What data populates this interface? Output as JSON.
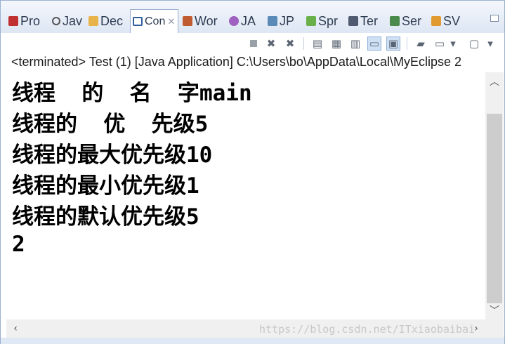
{
  "tabs": [
    {
      "label": "Pro",
      "icon": "problems-icon",
      "color": "#c03030"
    },
    {
      "label": "Jav",
      "icon": "javadoc-icon",
      "color": "#333333"
    },
    {
      "label": "Dec",
      "icon": "declaration-icon",
      "color": "#c88a20"
    },
    {
      "label": "Con",
      "icon": "console-icon",
      "color": "#3060a0",
      "active": true
    },
    {
      "label": "Wor",
      "icon": "workspace-icon",
      "color": "#b04020"
    },
    {
      "label": "JA",
      "icon": "jax-icon",
      "color": "#8040a0"
    },
    {
      "label": "JP",
      "icon": "jpa-icon",
      "color": "#2a6a9a"
    },
    {
      "label": "Spr",
      "icon": "spring-icon",
      "color": "#4a9a30"
    },
    {
      "label": "Ter",
      "icon": "terminal-icon",
      "color": "#404a60"
    },
    {
      "label": "Ser",
      "icon": "servers-icon",
      "color": "#3a7a3a"
    },
    {
      "label": "SV",
      "icon": "svn-icon",
      "color": "#d08020"
    }
  ],
  "toolbar": {
    "icons": [
      "terminate-icon",
      "remove-launch-icon",
      "remove-all-icon",
      "clear-console-icon",
      "scroll-lock-icon",
      "word-wrap-icon",
      "show-on-stdout-icon",
      "show-on-stderr-icon",
      "pin-console-icon",
      "display-console-icon",
      "dropdown-arrow-icon",
      "open-console-icon",
      "dropdown-arrow-icon"
    ]
  },
  "status": "<terminated> Test (1) [Java Application] C:\\Users\\bo\\AppData\\Local\\MyEclipse 2",
  "console": {
    "lines": [
      "线程  的  名  字main",
      "线程的  优  先级5",
      "线程的最大优先级10",
      "线程的最小优先级1",
      "线程的默认优先级5",
      "2"
    ]
  },
  "watermark": "https://blog.csdn.net/ITxiaobaibai",
  "colors": {
    "accent": "#9bb0cf",
    "active_tab": "#ffffff",
    "console_text": "#000000"
  }
}
